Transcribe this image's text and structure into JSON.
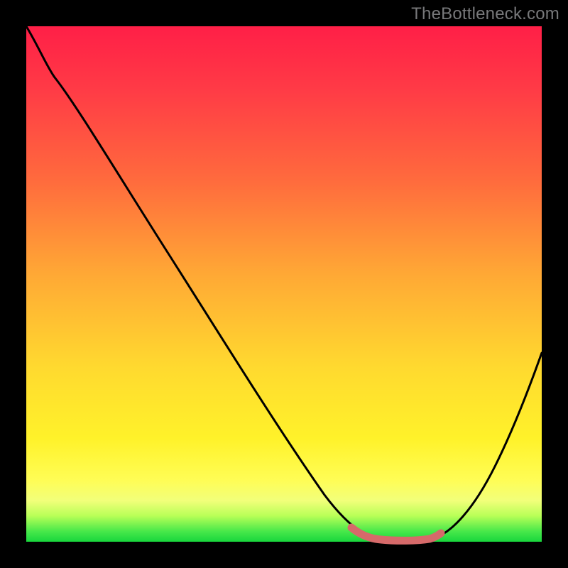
{
  "watermark": "TheBottleneck.com",
  "chart_data": {
    "type": "line",
    "title": "",
    "xlabel": "",
    "ylabel": "",
    "xlim": [
      0,
      100
    ],
    "ylim": [
      0,
      100
    ],
    "series": [
      {
        "name": "bottleneck-curve",
        "x": [
          0,
          3,
          6,
          10,
          15,
          20,
          25,
          30,
          35,
          40,
          45,
          50,
          55,
          60,
          63,
          65,
          68,
          72,
          75,
          78,
          82,
          86,
          90,
          94,
          98,
          100
        ],
        "values": [
          100,
          98,
          95,
          91,
          85,
          78,
          71,
          64,
          57,
          49,
          42,
          34,
          27,
          19,
          12,
          8,
          4,
          1,
          0,
          0,
          2,
          7,
          14,
          23,
          33,
          39
        ]
      },
      {
        "name": "optimal-range-marker",
        "x": [
          63,
          65,
          68,
          72,
          75,
          78
        ],
        "values": [
          2,
          1.2,
          0.6,
          0.3,
          0.3,
          0.6
        ]
      }
    ],
    "colors": {
      "curve": "#000000",
      "marker": "#d66a6a",
      "gradient_top": "#ff1f47",
      "gradient_bottom": "#18d63d"
    }
  }
}
